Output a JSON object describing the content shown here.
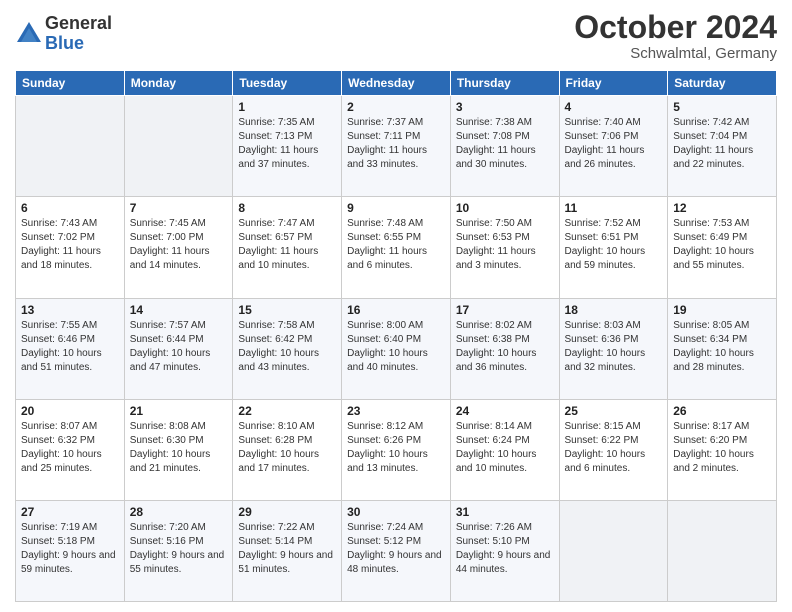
{
  "logo": {
    "general": "General",
    "blue": "Blue"
  },
  "header": {
    "month": "October 2024",
    "location": "Schwalmtal, Germany"
  },
  "weekdays": [
    "Sunday",
    "Monday",
    "Tuesday",
    "Wednesday",
    "Thursday",
    "Friday",
    "Saturday"
  ],
  "weeks": [
    [
      {
        "day": "",
        "info": ""
      },
      {
        "day": "",
        "info": ""
      },
      {
        "day": "1",
        "info": "Sunrise: 7:35 AM\nSunset: 7:13 PM\nDaylight: 11 hours and 37 minutes."
      },
      {
        "day": "2",
        "info": "Sunrise: 7:37 AM\nSunset: 7:11 PM\nDaylight: 11 hours and 33 minutes."
      },
      {
        "day": "3",
        "info": "Sunrise: 7:38 AM\nSunset: 7:08 PM\nDaylight: 11 hours and 30 minutes."
      },
      {
        "day": "4",
        "info": "Sunrise: 7:40 AM\nSunset: 7:06 PM\nDaylight: 11 hours and 26 minutes."
      },
      {
        "day": "5",
        "info": "Sunrise: 7:42 AM\nSunset: 7:04 PM\nDaylight: 11 hours and 22 minutes."
      }
    ],
    [
      {
        "day": "6",
        "info": "Sunrise: 7:43 AM\nSunset: 7:02 PM\nDaylight: 11 hours and 18 minutes."
      },
      {
        "day": "7",
        "info": "Sunrise: 7:45 AM\nSunset: 7:00 PM\nDaylight: 11 hours and 14 minutes."
      },
      {
        "day": "8",
        "info": "Sunrise: 7:47 AM\nSunset: 6:57 PM\nDaylight: 11 hours and 10 minutes."
      },
      {
        "day": "9",
        "info": "Sunrise: 7:48 AM\nSunset: 6:55 PM\nDaylight: 11 hours and 6 minutes."
      },
      {
        "day": "10",
        "info": "Sunrise: 7:50 AM\nSunset: 6:53 PM\nDaylight: 11 hours and 3 minutes."
      },
      {
        "day": "11",
        "info": "Sunrise: 7:52 AM\nSunset: 6:51 PM\nDaylight: 10 hours and 59 minutes."
      },
      {
        "day": "12",
        "info": "Sunrise: 7:53 AM\nSunset: 6:49 PM\nDaylight: 10 hours and 55 minutes."
      }
    ],
    [
      {
        "day": "13",
        "info": "Sunrise: 7:55 AM\nSunset: 6:46 PM\nDaylight: 10 hours and 51 minutes."
      },
      {
        "day": "14",
        "info": "Sunrise: 7:57 AM\nSunset: 6:44 PM\nDaylight: 10 hours and 47 minutes."
      },
      {
        "day": "15",
        "info": "Sunrise: 7:58 AM\nSunset: 6:42 PM\nDaylight: 10 hours and 43 minutes."
      },
      {
        "day": "16",
        "info": "Sunrise: 8:00 AM\nSunset: 6:40 PM\nDaylight: 10 hours and 40 minutes."
      },
      {
        "day": "17",
        "info": "Sunrise: 8:02 AM\nSunset: 6:38 PM\nDaylight: 10 hours and 36 minutes."
      },
      {
        "day": "18",
        "info": "Sunrise: 8:03 AM\nSunset: 6:36 PM\nDaylight: 10 hours and 32 minutes."
      },
      {
        "day": "19",
        "info": "Sunrise: 8:05 AM\nSunset: 6:34 PM\nDaylight: 10 hours and 28 minutes."
      }
    ],
    [
      {
        "day": "20",
        "info": "Sunrise: 8:07 AM\nSunset: 6:32 PM\nDaylight: 10 hours and 25 minutes."
      },
      {
        "day": "21",
        "info": "Sunrise: 8:08 AM\nSunset: 6:30 PM\nDaylight: 10 hours and 21 minutes."
      },
      {
        "day": "22",
        "info": "Sunrise: 8:10 AM\nSunset: 6:28 PM\nDaylight: 10 hours and 17 minutes."
      },
      {
        "day": "23",
        "info": "Sunrise: 8:12 AM\nSunset: 6:26 PM\nDaylight: 10 hours and 13 minutes."
      },
      {
        "day": "24",
        "info": "Sunrise: 8:14 AM\nSunset: 6:24 PM\nDaylight: 10 hours and 10 minutes."
      },
      {
        "day": "25",
        "info": "Sunrise: 8:15 AM\nSunset: 6:22 PM\nDaylight: 10 hours and 6 minutes."
      },
      {
        "day": "26",
        "info": "Sunrise: 8:17 AM\nSunset: 6:20 PM\nDaylight: 10 hours and 2 minutes."
      }
    ],
    [
      {
        "day": "27",
        "info": "Sunrise: 7:19 AM\nSunset: 5:18 PM\nDaylight: 9 hours and 59 minutes."
      },
      {
        "day": "28",
        "info": "Sunrise: 7:20 AM\nSunset: 5:16 PM\nDaylight: 9 hours and 55 minutes."
      },
      {
        "day": "29",
        "info": "Sunrise: 7:22 AM\nSunset: 5:14 PM\nDaylight: 9 hours and 51 minutes."
      },
      {
        "day": "30",
        "info": "Sunrise: 7:24 AM\nSunset: 5:12 PM\nDaylight: 9 hours and 48 minutes."
      },
      {
        "day": "31",
        "info": "Sunrise: 7:26 AM\nSunset: 5:10 PM\nDaylight: 9 hours and 44 minutes."
      },
      {
        "day": "",
        "info": ""
      },
      {
        "day": "",
        "info": ""
      }
    ]
  ]
}
